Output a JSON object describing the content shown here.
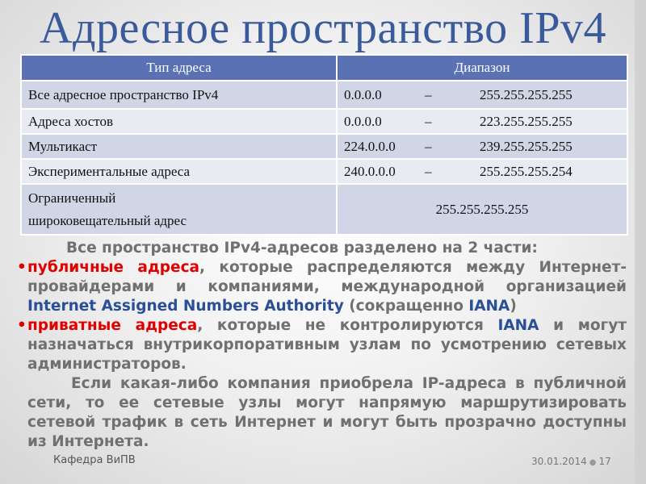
{
  "slide": {
    "title": "Адресное пространство IPv4",
    "table": {
      "headers": [
        "Тип адреса",
        "Диапазон"
      ],
      "rows": [
        {
          "type": "Все адресное пространство IPv4",
          "start": "0.0.0.0",
          "dash": "–",
          "end": "255.255.255.255"
        },
        {
          "type": "Адреса хостов",
          "start": "0.0.0.0",
          "dash": "–",
          "end": "223.255.255.255"
        },
        {
          "type": "Мультикаст",
          "start": "224.0.0.0",
          "dash": "–",
          "end": "239.255.255.255"
        },
        {
          "type": "Экспериментальные адреса",
          "start": "240.0.0.0",
          "dash": "–",
          "end": "255.255.255.254"
        },
        {
          "type_line1": "Ограниченный",
          "type_line2": "широковещательный адрес",
          "single": "255.255.255.255"
        }
      ]
    },
    "intro": "Все пространство IPv4-адресов разделено на 2 части:",
    "bullets": [
      {
        "marker": "•",
        "highlight": "публичные адреса",
        "text_before_blue": ", которые распределяются между Интернет-провайдерами и компаниями, международной организацией ",
        "blue_term": "Internet Assigned Numbers Authority",
        "text_after_blue": " (сокращенно ",
        "blue_abbr": "IANA",
        "text_end": ")"
      },
      {
        "marker": "•",
        "highlight": "приватные адреса",
        "text_before_blue": ", которые не контролируются ",
        "blue_abbr": "IANA",
        "text_end": " и могут назначаться внутрикорпоративным узлам по усмотрению сетевых администраторов."
      }
    ],
    "closing": "Если какая-либо компания приобрела IP-адреса в публичной сети, то ее сетевые узлы могут напрямую маршрутизировать сетевой трафик в сеть Интернет и могут быть прозрачно доступны из Интернета.",
    "footer": {
      "left": "Кафедра ВиПВ",
      "date": "30.01.2014",
      "separator": "●",
      "page": "17"
    },
    "colors": {
      "title": "#3a5a9c",
      "header_bg": "#5a72b4",
      "row_odd": "#d0d6e5",
      "row_even": "#e8ebf2",
      "highlight_red": "#e00000",
      "term_blue": "#2a4f96",
      "body_gray": "#707070"
    }
  }
}
